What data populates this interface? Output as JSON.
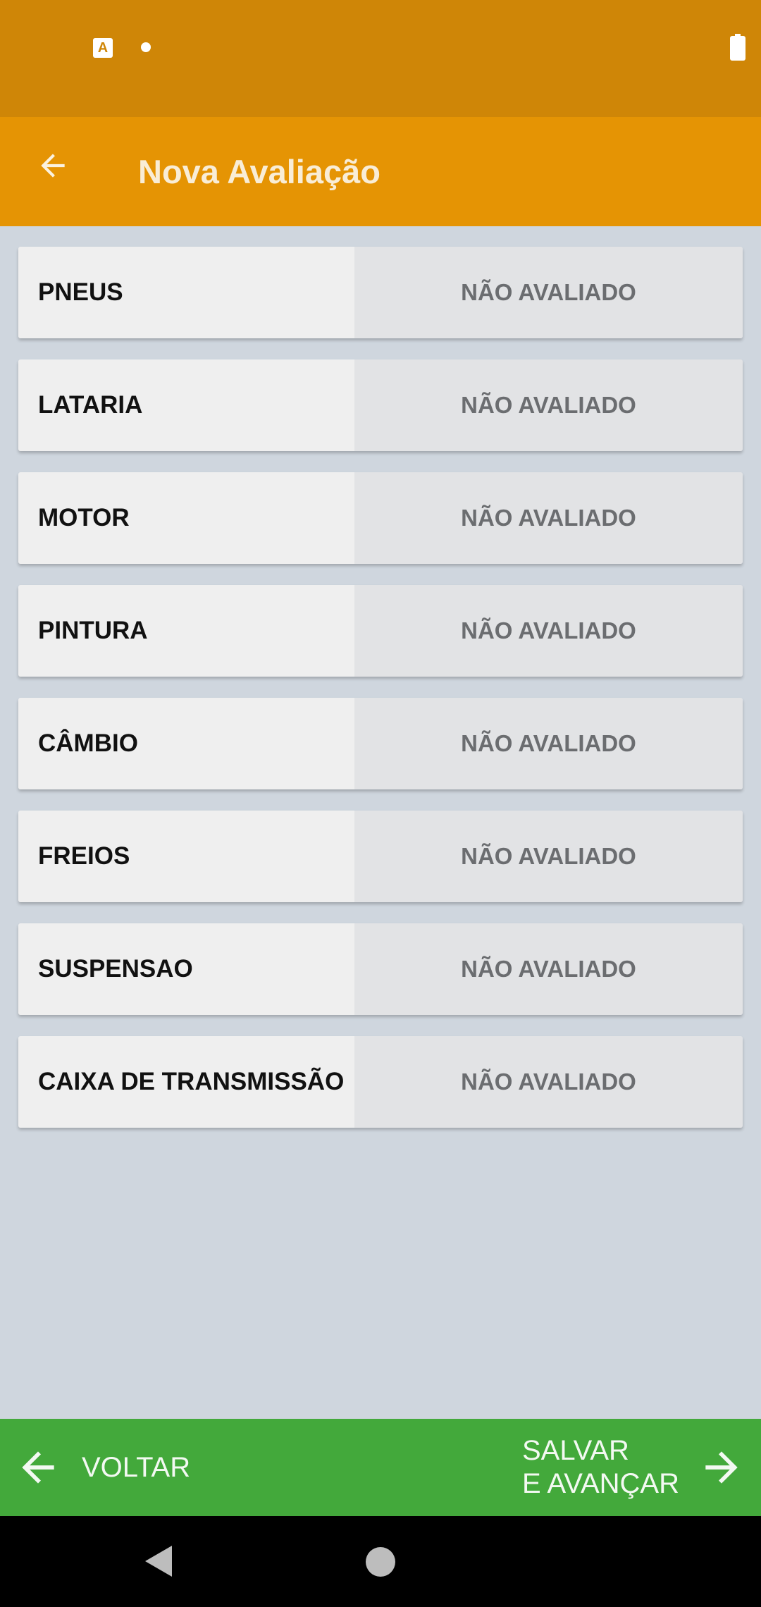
{
  "status_bar": {
    "notification_icon": "text-a-icon",
    "battery_icon": "battery-icon"
  },
  "app_bar": {
    "title": "Nova Avaliação",
    "back_icon": "arrow-left-icon"
  },
  "items": [
    {
      "label": "PNEUS",
      "status": "NÃO AVALIADO"
    },
    {
      "label": "LATARIA",
      "status": "NÃO AVALIADO"
    },
    {
      "label": "MOTOR",
      "status": "NÃO AVALIADO"
    },
    {
      "label": "PINTURA",
      "status": "NÃO AVALIADO"
    },
    {
      "label": "CÂMBIO",
      "status": "NÃO AVALIADO"
    },
    {
      "label": "FREIOS",
      "status": "NÃO AVALIADO"
    },
    {
      "label": "SUSPENSAO",
      "status": "NÃO AVALIADO"
    },
    {
      "label": "CAIXA DE TRANSMISSÃO",
      "status": "NÃO AVALIADO"
    }
  ],
  "bottom_bar": {
    "back_label": "VOLTAR",
    "next_label_line1": "SALVAR",
    "next_label_line2": "E AVANÇAR"
  },
  "colors": {
    "status_bar": "#cf8607",
    "app_bar": "#e59404",
    "bottom_bar": "#43a93b",
    "background": "#cfd6de"
  }
}
